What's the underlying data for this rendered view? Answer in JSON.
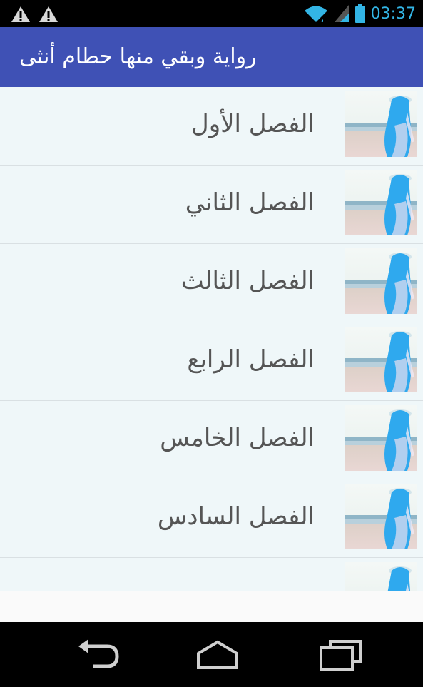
{
  "status_bar": {
    "time": "03:37",
    "icons": [
      "warning-icon",
      "warning-icon",
      "wifi-icon",
      "signal-icon",
      "battery-icon"
    ]
  },
  "app_bar": {
    "title": "رواية وبقي منها حطام أنثى"
  },
  "chapters": [
    {
      "label": "الفصل الأول"
    },
    {
      "label": "الفصل الثاني"
    },
    {
      "label": "الفصل الثالث"
    },
    {
      "label": "الفصل الرابع"
    },
    {
      "label": "الفصل الخامس"
    },
    {
      "label": "الفصل السادس"
    },
    {
      "label": ""
    }
  ],
  "nav_bar": {
    "buttons": [
      "back-icon",
      "home-icon",
      "recents-icon"
    ]
  },
  "colors": {
    "app_bar": "#3f51b5",
    "status_accent": "#33b5e5",
    "list_background": "#eff7f9"
  }
}
